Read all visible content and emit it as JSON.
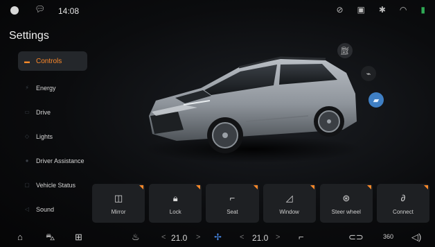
{
  "status_bar": {
    "time": "14:08",
    "icons": [
      "avatar-icon",
      "message-icon",
      "no-camera-icon",
      "dashcam-icon",
      "bluetooth-icon",
      "wifi-icon",
      "signal-icon"
    ]
  },
  "page": {
    "title": "Settings"
  },
  "menu": {
    "items": [
      {
        "label": "Controls",
        "icon": "car-icon",
        "active": true
      },
      {
        "label": "Energy",
        "icon": "energy-icon",
        "active": false
      },
      {
        "label": "Drive",
        "icon": "drive-icon",
        "active": false
      },
      {
        "label": "Lights",
        "icon": "lights-icon",
        "active": false
      },
      {
        "label": "Driver Assistance",
        "icon": "assist-icon",
        "active": false
      },
      {
        "label": "Vehicle Status",
        "icon": "vehicle-status-icon",
        "active": false
      },
      {
        "label": "Sound",
        "icon": "sound-icon",
        "active": false
      }
    ]
  },
  "quick_buttons": [
    "fuel-door-icon",
    "charge-port-icon",
    "seat-view-icon"
  ],
  "cards": [
    {
      "label": "Mirror",
      "icon": "mirror-icon"
    },
    {
      "label": "Lock",
      "icon": "lock-icon"
    },
    {
      "label": "Seat",
      "icon": "seat-icon"
    },
    {
      "label": "Window",
      "icon": "window-icon"
    },
    {
      "label": "Steer wheel",
      "icon": "steering-wheel-icon"
    },
    {
      "label": "Connect",
      "icon": "connect-icon"
    }
  ],
  "dock": {
    "temp_left": "21.0",
    "temp_right": "21.0",
    "auto_360_label": "360"
  },
  "colors": {
    "accent": "#ff8a2a",
    "blue": "#3f7fc4",
    "background": "#0b0c0e"
  }
}
